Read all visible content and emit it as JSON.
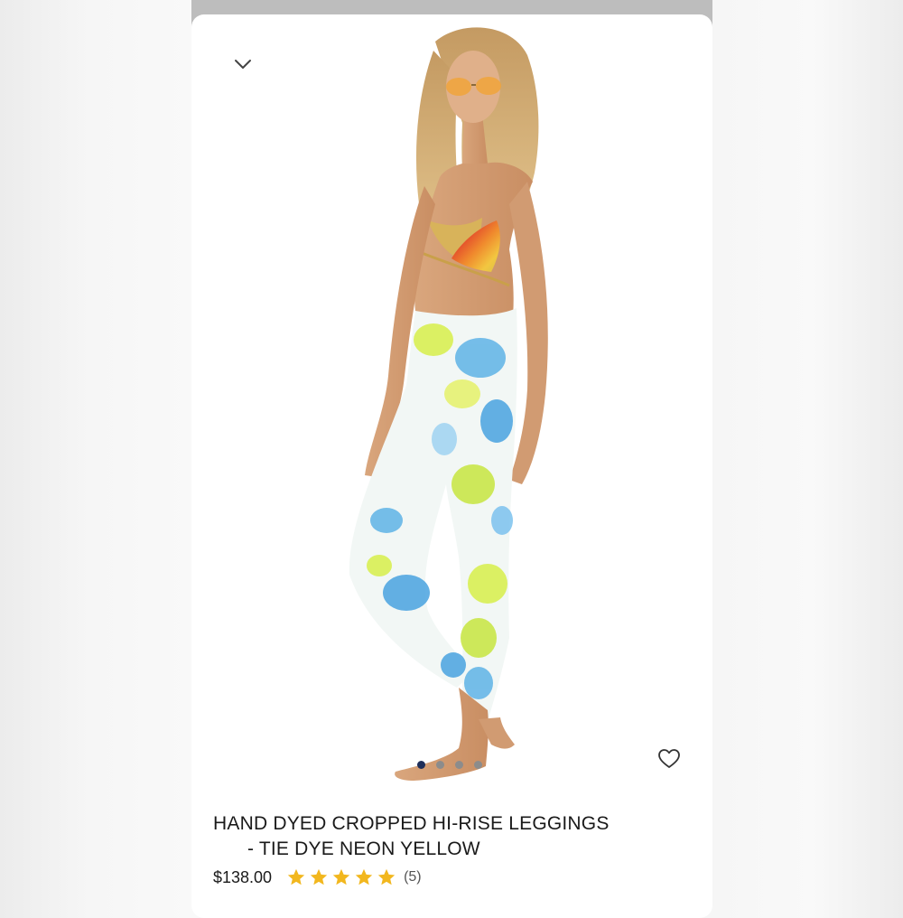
{
  "product": {
    "title_line1": "HAND DYED CROPPED HI-RISE LEGGINGS",
    "title_line2": "- TIE DYE NEON YELLOW",
    "price": "$138.00",
    "rating": 5,
    "rating_max": 5,
    "review_count": "(5)"
  },
  "gallery": {
    "image_count": 4,
    "active_index": 0
  },
  "icons": {
    "collapse": "chevron-down-icon",
    "wishlist": "heart-icon",
    "rating": "star-icon"
  },
  "colors": {
    "star": "#f2b71e",
    "active_dot": "#1f2f5a",
    "inactive_dot": "#8c8c8c"
  }
}
